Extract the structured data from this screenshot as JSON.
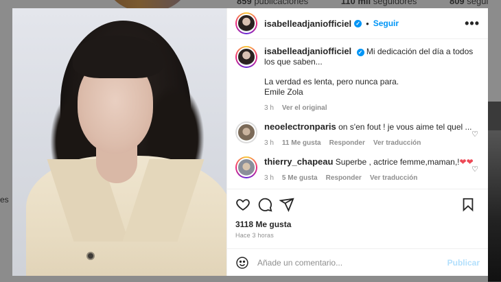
{
  "background": {
    "stats": [
      {
        "value": "859",
        "label": "publicaciones"
      },
      {
        "value": "110 mil",
        "label": "seguidores"
      },
      {
        "value": "809",
        "label": "seguidos"
      }
    ],
    "left_text": "es"
  },
  "post": {
    "username": "isabelleadjaniofficiel",
    "verified": true,
    "follow_label": "Seguir",
    "separator": "•",
    "more_label": "•••",
    "caption_lines": [
      "Mi dedicación del día a todos los que saben..."
    ],
    "caption_quote": "La verdad es lenta, pero nunca para.",
    "caption_author": "Emile Zola",
    "caption_time": "3 h",
    "caption_link": "Ver el original",
    "likes": "3118 Me gusta",
    "posted_ago": "Hace 3 horas"
  },
  "comments": [
    {
      "username": "neoelectronparis",
      "text": "on s'en fout ! je vous aime tel quel ...",
      "time": "3 h",
      "likes": "11 Me gusta",
      "reply": "Responder",
      "translate": "Ver traducción"
    },
    {
      "username": "thierry_chapeau",
      "text": "Superbe , actrice femme,maman,!",
      "hearts": "❤❤",
      "time": "3 h",
      "likes": "5 Me gusta",
      "reply": "Responder",
      "translate": "Ver traducción"
    }
  ],
  "add_comment": {
    "placeholder": "Añade un comentario...",
    "publish_label": "Publicar"
  },
  "colors": {
    "accent": "#0095f6",
    "like_red": "#ed4956"
  }
}
